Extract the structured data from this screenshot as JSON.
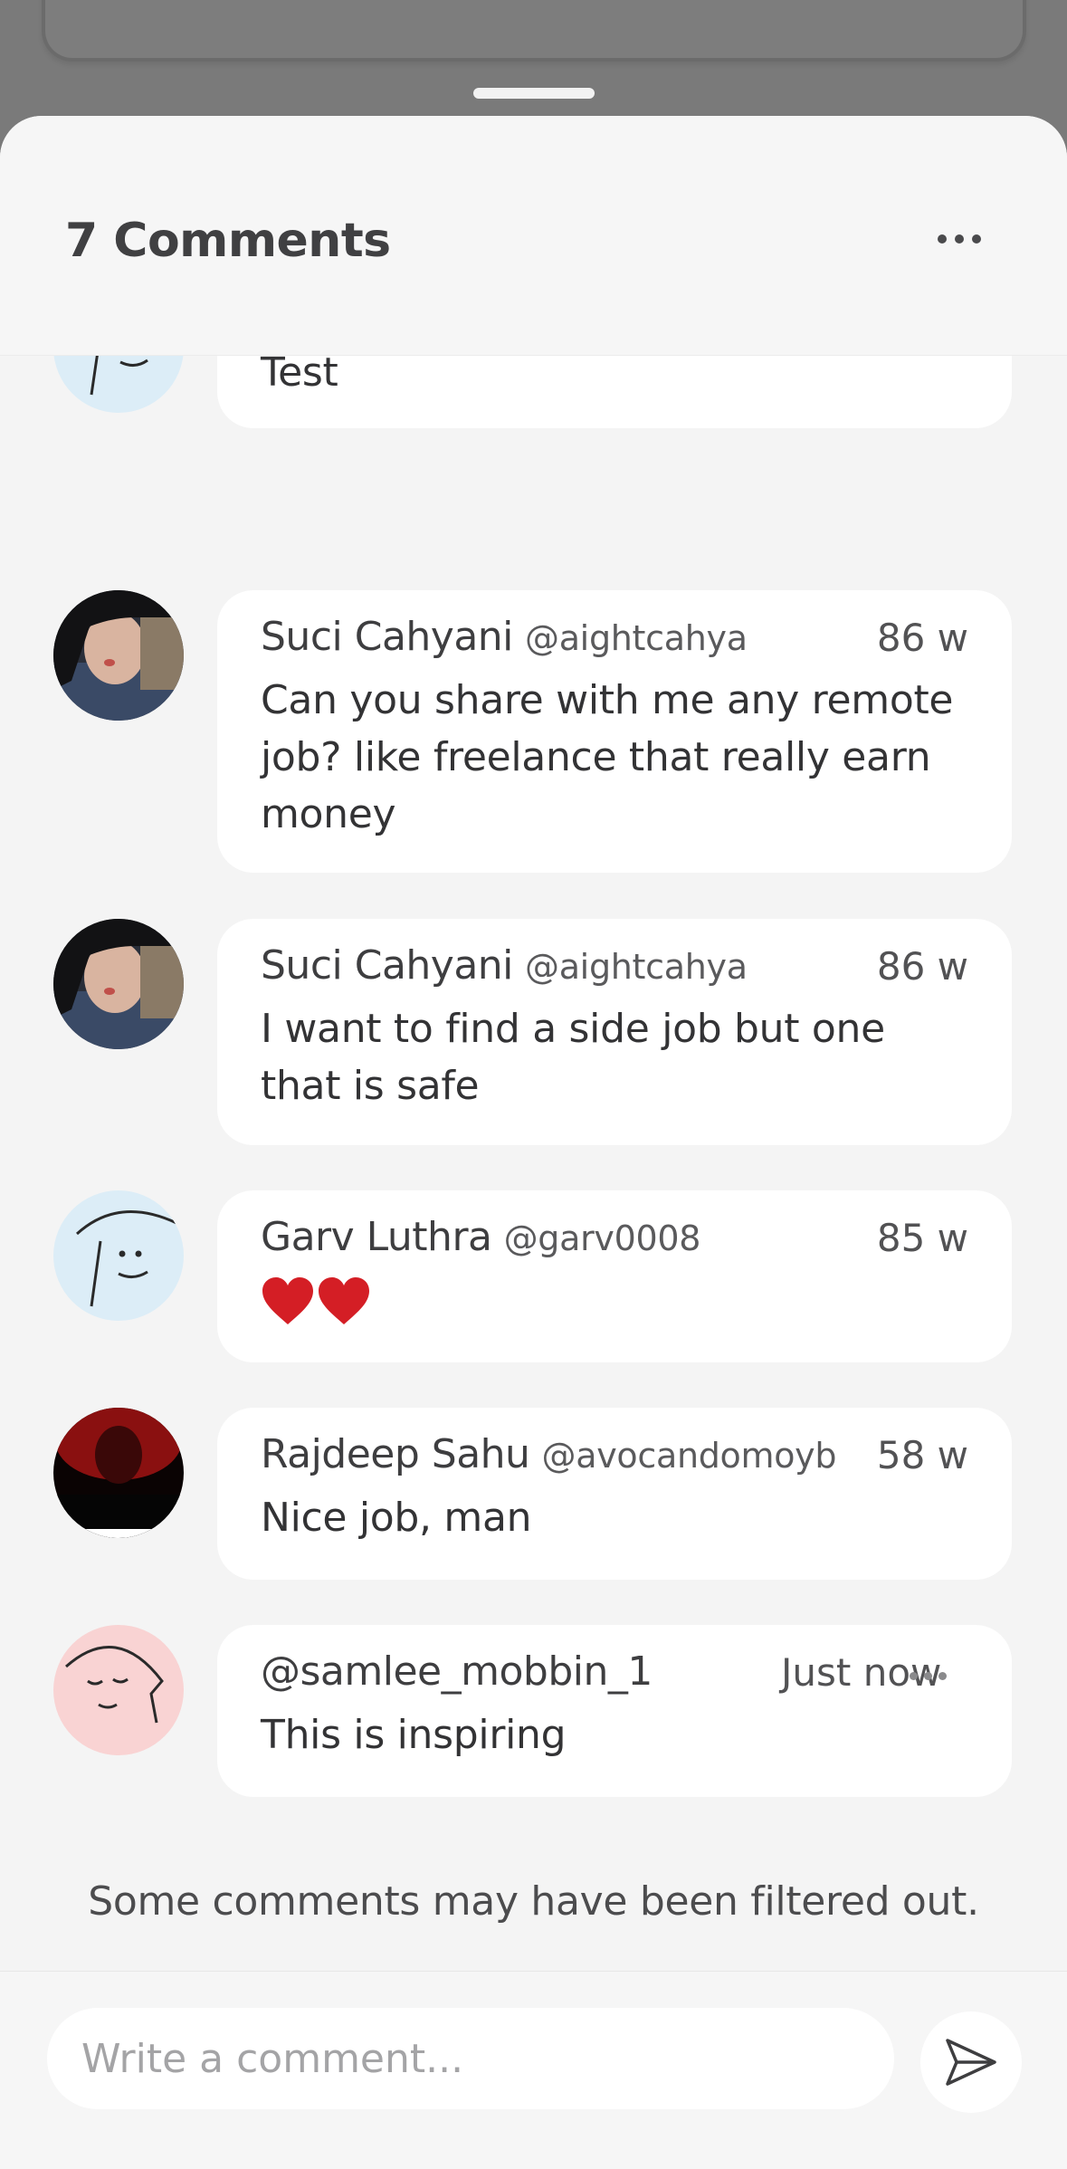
{
  "sheet": {
    "title": "7 Comments"
  },
  "comments": [
    {
      "text": "Test",
      "avatar": "doodle-face-avatar"
    },
    {
      "author": "Suci Cahyani",
      "handle": "@aightcahya",
      "time": "86 w",
      "text": "Can you share with me any remote job? like freelance that really earn money",
      "avatar": "photo-avatar"
    },
    {
      "author": "Suci Cahyani",
      "handle": "@aightcahya",
      "time": "86 w",
      "text": "I want to find a side job but one that is safe",
      "avatar": "photo-avatar"
    },
    {
      "author": "Garv Luthra",
      "handle": "@garv0008",
      "time": "85 w",
      "text": "❤️❤️",
      "avatar": "doodle-face-avatar"
    },
    {
      "author": "Rajdeep Sahu",
      "handle": "@avocandomoyb",
      "time": "58 w",
      "text": "Nice job, man",
      "avatar": "photo-avatar"
    },
    {
      "author": "@samlee_mobbin_1",
      "time": "Just now",
      "text": "This is inspiring",
      "avatar": "doodle-face-avatar"
    }
  ],
  "filter_note": "Some comments may have been filtered out.",
  "composer": {
    "placeholder": "Write a comment..."
  },
  "colors": {
    "backdrop": "#7a7a7a",
    "sheet_background": "#f4f4f4",
    "bubble_background": "#ffffff",
    "text_primary": "#3e3e40",
    "avatar_blue": "#dcedf7",
    "avatar_pink": "#f9d3d3"
  }
}
